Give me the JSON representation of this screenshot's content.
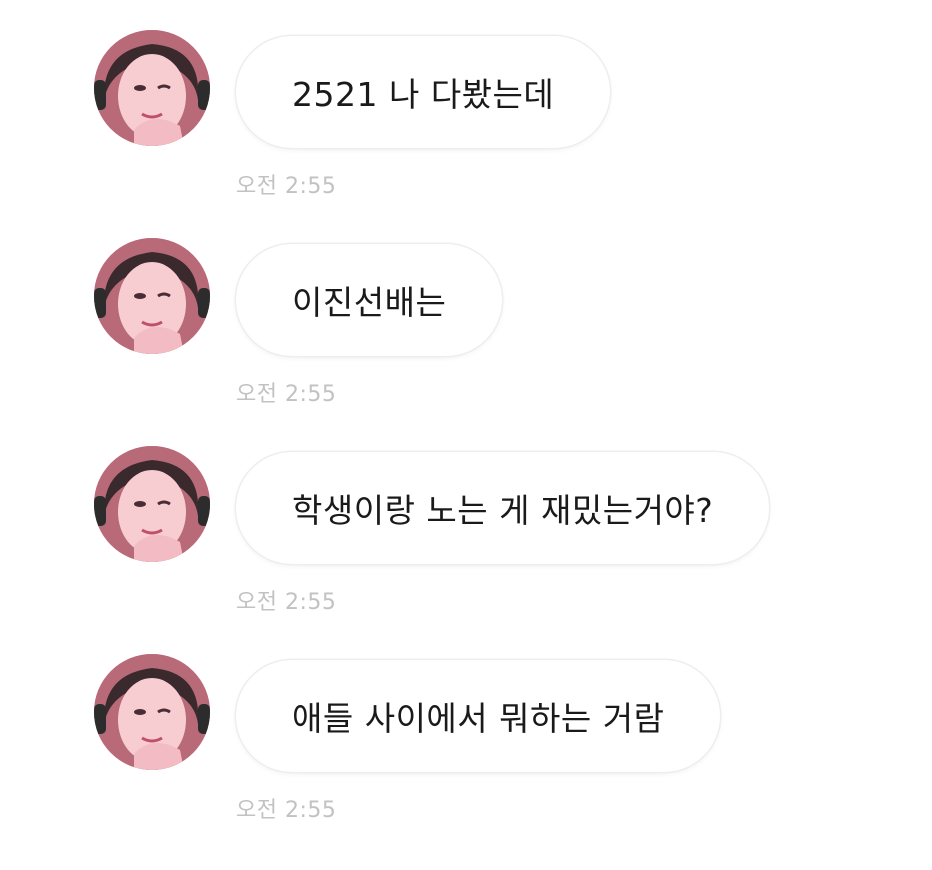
{
  "messages": [
    {
      "text": "2521 나 다봤는데",
      "time": "오전 2:55"
    },
    {
      "text": "이진선배는",
      "time": "오전 2:55"
    },
    {
      "text": "학생이랑 노는 게 재밌는거야?",
      "time": "오전 2:55"
    },
    {
      "text": "애들 사이에서 뭐하는 거람",
      "time": "오전 2:55"
    }
  ],
  "colors": {
    "bubble_bg": "#ffffff",
    "bubble_border": "#eeeeee",
    "text": "#1a1a1a",
    "timestamp": "#c2c2c2"
  }
}
